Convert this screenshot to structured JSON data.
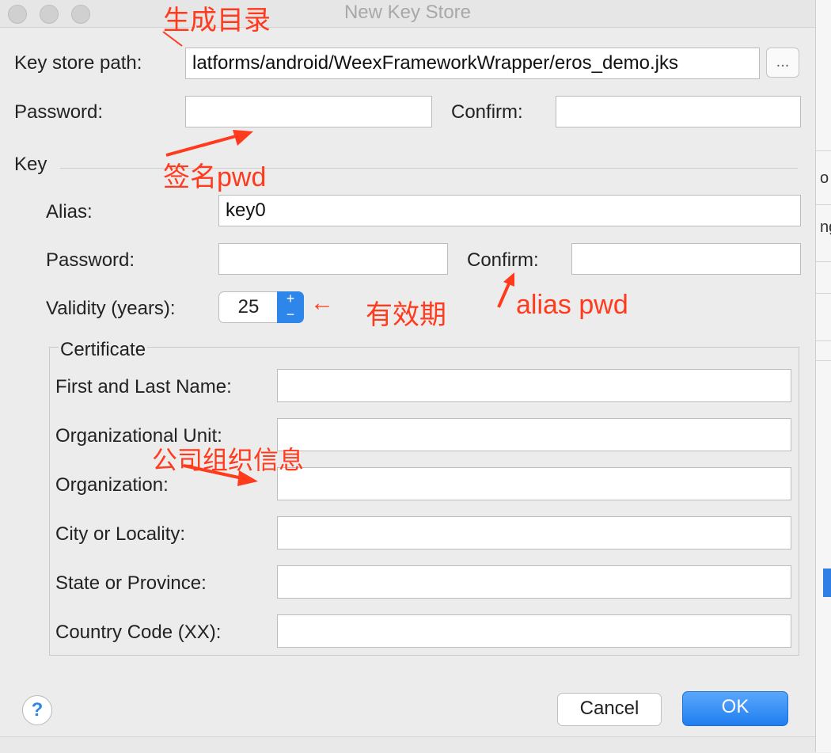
{
  "window": {
    "title": "New Key Store"
  },
  "keystore": {
    "path_label": "Key store path:",
    "path_value": "latforms/android/WeexFrameworkWrapper/eros_demo.jks",
    "browse_label": "...",
    "password_label": "Password:",
    "password_value": "",
    "confirm_label": "Confirm:",
    "confirm_value": ""
  },
  "key": {
    "section_label": "Key",
    "alias_label": "Alias:",
    "alias_value": "key0",
    "password_label": "Password:",
    "password_value": "",
    "confirm_label": "Confirm:",
    "confirm_value": "",
    "validity_label": "Validity (years):",
    "validity_value": "25",
    "stepper_up": "+",
    "stepper_down": "−"
  },
  "certificate": {
    "legend": "Certificate",
    "fields": [
      {
        "label": "First and Last Name:",
        "value": ""
      },
      {
        "label": "Organizational Unit:",
        "value": ""
      },
      {
        "label": "Organization:",
        "value": ""
      },
      {
        "label": "City or Locality:",
        "value": ""
      },
      {
        "label": "State or Province:",
        "value": ""
      },
      {
        "label": "Country Code (XX):",
        "value": ""
      }
    ]
  },
  "buttons": {
    "help": "?",
    "cancel": "Cancel",
    "ok": "OK"
  },
  "annotations": {
    "generate_dir": "生成目录",
    "sign_pwd": "签名pwd",
    "validity": "有效期",
    "alias_pwd": "alias pwd",
    "company_info": "公司组织信息",
    "arrow_left": "←"
  },
  "background_window": {
    "chars": [
      "o",
      "ng"
    ]
  },
  "colors": {
    "annotation": "#ff3a1d",
    "accent": "#2f86ea"
  }
}
